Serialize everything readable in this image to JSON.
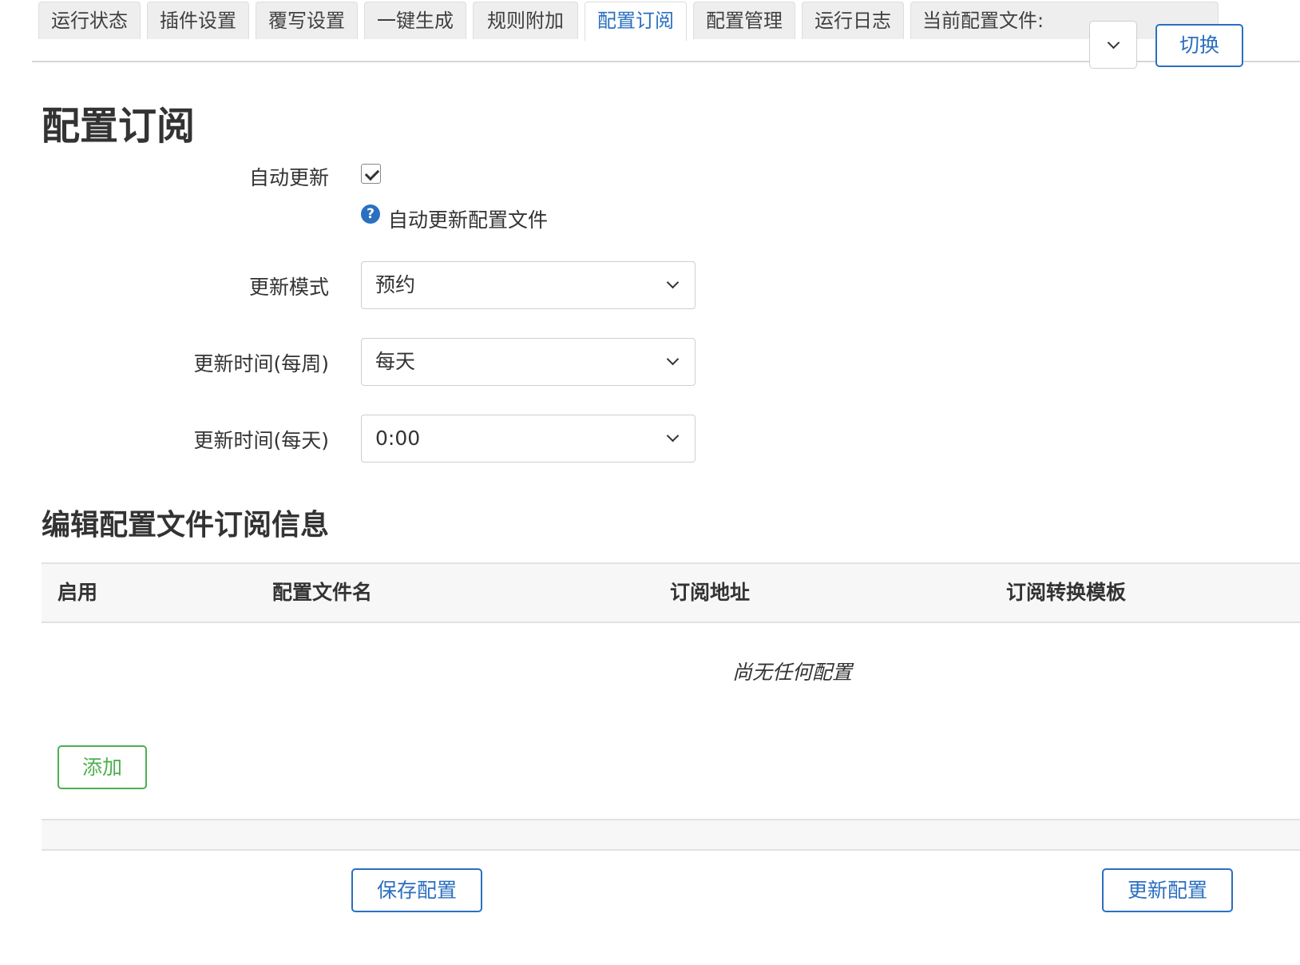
{
  "tabs": [
    {
      "label": "运行状态",
      "active": false
    },
    {
      "label": "插件设置",
      "active": false
    },
    {
      "label": "覆写设置",
      "active": false
    },
    {
      "label": "一键生成",
      "active": false
    },
    {
      "label": "规则附加",
      "active": false
    },
    {
      "label": "配置订阅",
      "active": true
    },
    {
      "label": "配置管理",
      "active": false
    },
    {
      "label": "运行日志",
      "active": false
    }
  ],
  "config_switch": {
    "label": "当前配置文件:",
    "selected": "",
    "button": "切换"
  },
  "page_title": "配置订阅",
  "form": {
    "auto_update": {
      "label": "自动更新",
      "checked": true,
      "help": "自动更新配置文件"
    },
    "update_mode": {
      "label": "更新模式",
      "value": "预约"
    },
    "update_week": {
      "label": "更新时间(每周)",
      "value": "每天"
    },
    "update_day": {
      "label": "更新时间(每天)",
      "value": "0:00"
    }
  },
  "section_title": "编辑配置文件订阅信息",
  "table": {
    "columns": [
      "启用",
      "配置文件名",
      "订阅地址",
      "订阅转换模板"
    ],
    "rows": [],
    "empty_text": "尚无任何配置"
  },
  "add_button": "添加",
  "footer": {
    "save": "保存配置",
    "update": "更新配置"
  },
  "colors": {
    "accent": "#2b6fc0",
    "add": "#4caf50"
  }
}
